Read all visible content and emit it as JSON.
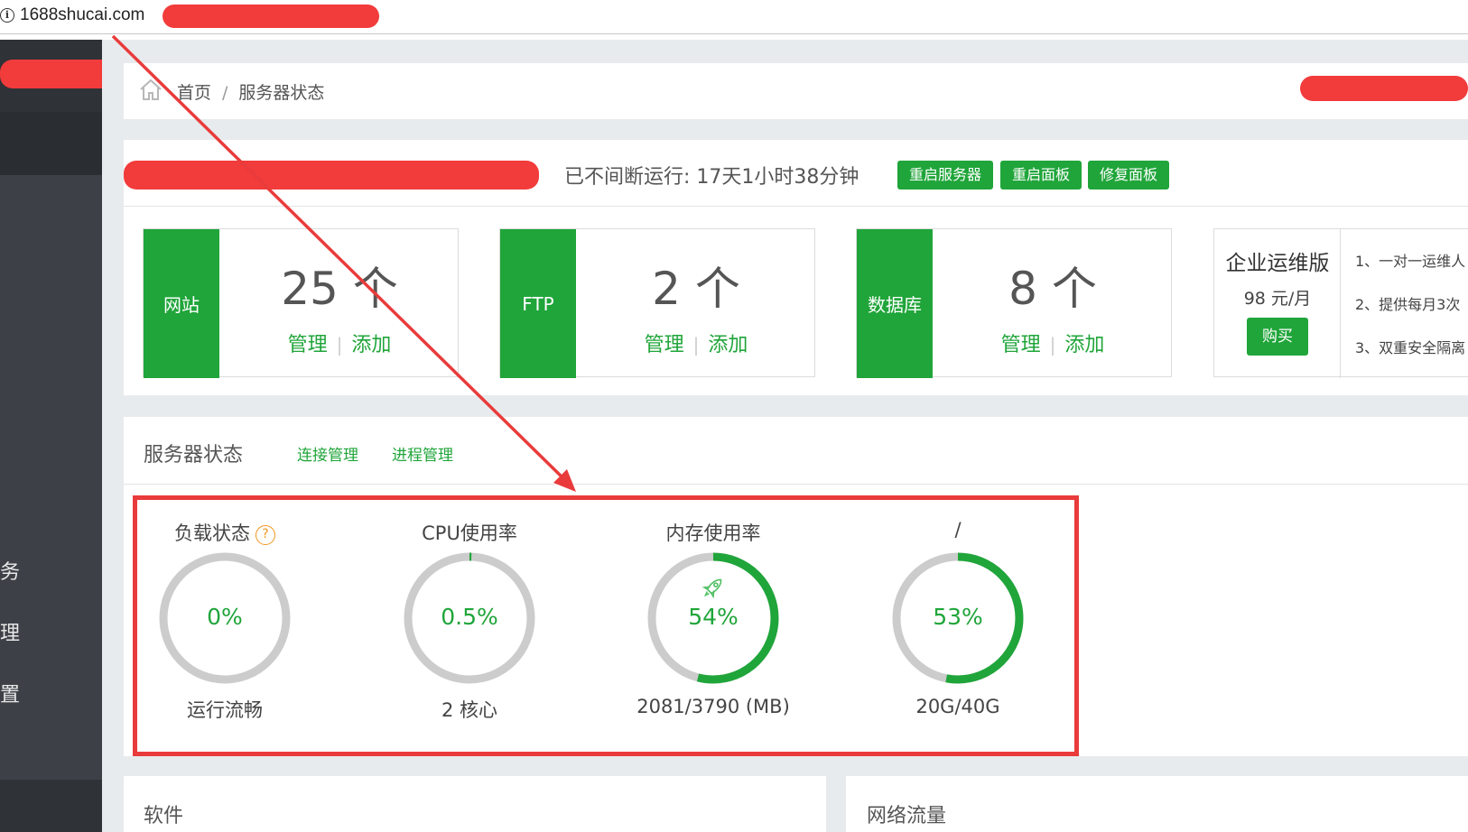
{
  "browser": {
    "url": "1688shucai.com"
  },
  "sidebar": {
    "items": [
      {
        "label": "务"
      },
      {
        "label": "理"
      },
      {
        "label": "置"
      }
    ]
  },
  "breadcrumb": {
    "home": "首页",
    "separator": "/",
    "current": "服务器状态"
  },
  "header": {
    "uptime": "已不间断运行: 17天1小时38分钟",
    "buttons": {
      "restart_server": "重启服务器",
      "restart_panel": "重启面板",
      "repair_panel": "修复面板"
    }
  },
  "stats": [
    {
      "tag": "网站",
      "count": "25 个",
      "manage": "管理",
      "add": "添加"
    },
    {
      "tag": "FTP",
      "count": "2 个",
      "manage": "管理",
      "add": "添加"
    },
    {
      "tag": "数据库",
      "count": "8 个",
      "manage": "管理",
      "add": "添加"
    }
  ],
  "promo": {
    "title": "企业运维版",
    "price": "98 元/月",
    "buy": "购买",
    "features": [
      "1、一对一运维人",
      "2、提供每月3次",
      "3、双重安全隔离"
    ]
  },
  "server_status": {
    "title": "服务器状态",
    "links": {
      "connections": "连接管理",
      "processes": "进程管理"
    },
    "gauges": [
      {
        "title": "负载状态",
        "value": "0%",
        "percent": 0,
        "sub": "运行流畅",
        "icon": "help-icon"
      },
      {
        "title": "CPU使用率",
        "value": "0.5%",
        "percent": 0.5,
        "sub": "2 核心"
      },
      {
        "title": "内存使用率",
        "value": "54%",
        "percent": 54,
        "sub": "2081/3790 (MB)",
        "icon": "rocket-icon"
      },
      {
        "title": "/",
        "value": "53%",
        "percent": 53,
        "sub": "20G/40G"
      }
    ]
  },
  "bottom": {
    "software": "软件",
    "network": "网络流量"
  },
  "colors": {
    "accent": "#20a53a",
    "annotation": "#e93b3b",
    "track": "#cccccc",
    "sidebar": "#3d4147"
  }
}
